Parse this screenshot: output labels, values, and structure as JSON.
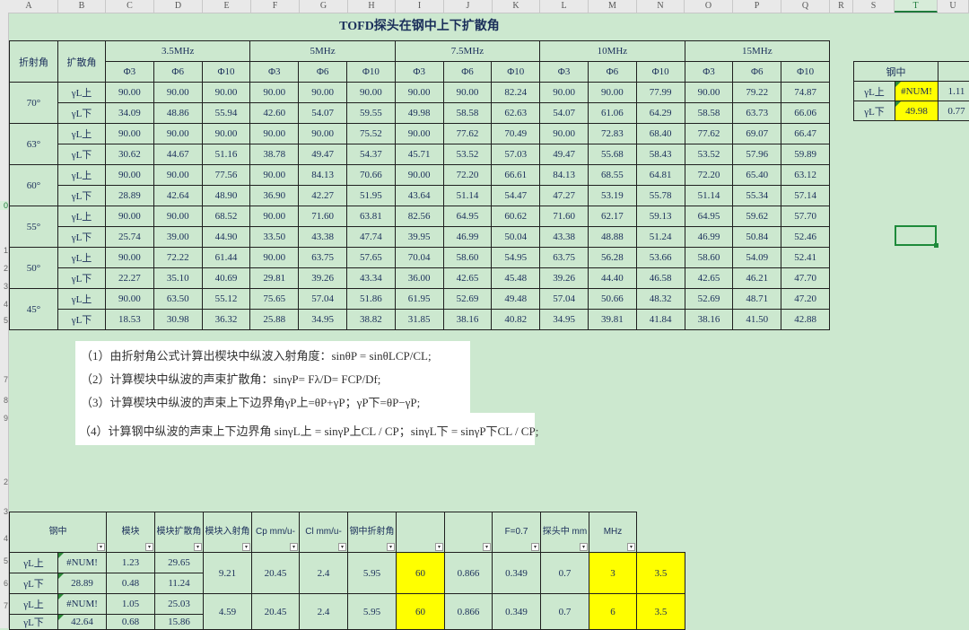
{
  "columns": [
    "A",
    "B",
    "C",
    "D",
    "E",
    "F",
    "G",
    "H",
    "I",
    "J",
    "K",
    "L",
    "M",
    "N",
    "O",
    "P",
    "Q",
    "R",
    "S",
    "T",
    "U"
  ],
  "selected_column": "T",
  "row_numbers": [
    "0",
    "1",
    "2",
    "3",
    "4",
    "5",
    "6",
    "7",
    "8"
  ],
  "title": "TOFD探头在钢中上下扩散角",
  "main_table": {
    "h_refraction": "折射角",
    "h_spread": "扩散角",
    "freqs": [
      "3.5MHz",
      "5MHz",
      "7.5MHz",
      "10MHz",
      "15MHz"
    ],
    "phis": [
      "Φ3",
      "Φ6",
      "Φ10",
      "Φ3",
      "Φ6",
      "Φ10",
      "Φ3",
      "Φ6",
      "Φ10",
      "Φ3",
      "Φ6",
      "Φ10",
      "Φ3",
      "Φ6",
      "Φ10"
    ],
    "groups": [
      {
        "angle": "70°",
        "up": [
          "90.00",
          "90.00",
          "90.00",
          "90.00",
          "90.00",
          "90.00",
          "90.00",
          "90.00",
          "82.24",
          "90.00",
          "90.00",
          "77.99",
          "90.00",
          "79.22",
          "74.87"
        ],
        "down": [
          "34.09",
          "48.86",
          "55.94",
          "42.60",
          "54.07",
          "59.55",
          "49.98",
          "58.58",
          "62.63",
          "54.07",
          "61.06",
          "64.29",
          "58.58",
          "63.73",
          "66.06"
        ]
      },
      {
        "angle": "63°",
        "up": [
          "90.00",
          "90.00",
          "90.00",
          "90.00",
          "90.00",
          "75.52",
          "90.00",
          "77.62",
          "70.49",
          "90.00",
          "72.83",
          "68.40",
          "77.62",
          "69.07",
          "66.47"
        ],
        "down": [
          "30.62",
          "44.67",
          "51.16",
          "38.78",
          "49.47",
          "54.37",
          "45.71",
          "53.52",
          "57.03",
          "49.47",
          "55.68",
          "58.43",
          "53.52",
          "57.96",
          "59.89"
        ]
      },
      {
        "angle": "60°",
        "up": [
          "90.00",
          "90.00",
          "77.56",
          "90.00",
          "84.13",
          "70.66",
          "90.00",
          "72.20",
          "66.61",
          "84.13",
          "68.55",
          "64.81",
          "72.20",
          "65.40",
          "63.12"
        ],
        "down": [
          "28.89",
          "42.64",
          "48.90",
          "36.90",
          "42.27",
          "51.95",
          "43.64",
          "51.14",
          "54.47",
          "47.27",
          "53.19",
          "55.78",
          "51.14",
          "55.34",
          "57.14"
        ]
      },
      {
        "angle": "55°",
        "up": [
          "90.00",
          "90.00",
          "68.52",
          "90.00",
          "71.60",
          "63.81",
          "82.56",
          "64.95",
          "60.62",
          "71.60",
          "62.17",
          "59.13",
          "64.95",
          "59.62",
          "57.70"
        ],
        "down": [
          "25.74",
          "39.00",
          "44.90",
          "33.50",
          "43.38",
          "47.74",
          "39.95",
          "46.99",
          "50.04",
          "43.38",
          "48.88",
          "51.24",
          "46.99",
          "50.84",
          "52.46"
        ]
      },
      {
        "angle": "50°",
        "up": [
          "90.00",
          "72.22",
          "61.44",
          "90.00",
          "63.75",
          "57.65",
          "70.04",
          "58.60",
          "54.95",
          "63.75",
          "56.28",
          "53.66",
          "58.60",
          "54.09",
          "52.41"
        ],
        "down": [
          "22.27",
          "35.10",
          "40.69",
          "29.81",
          "39.26",
          "43.34",
          "36.00",
          "42.65",
          "45.48",
          "39.26",
          "44.40",
          "46.58",
          "42.65",
          "46.21",
          "47.70"
        ]
      },
      {
        "angle": "45°",
        "up": [
          "90.00",
          "63.50",
          "55.12",
          "75.65",
          "57.04",
          "51.86",
          "61.95",
          "52.69",
          "49.48",
          "57.04",
          "50.66",
          "48.32",
          "52.69",
          "48.71",
          "47.20"
        ],
        "down": [
          "18.53",
          "30.98",
          "36.32",
          "25.88",
          "34.95",
          "38.82",
          "31.85",
          "38.16",
          "40.82",
          "34.95",
          "39.81",
          "41.84",
          "38.16",
          "41.50",
          "42.88"
        ]
      }
    ],
    "label_up": "γL上",
    "label_down": "γL下"
  },
  "side_table": {
    "header": "钢中",
    "rows": [
      {
        "label": "γL上",
        "v1": "#NUM!",
        "v2": "1.11"
      },
      {
        "label": "γL下",
        "v1": "49.98",
        "v2": "0.77"
      }
    ]
  },
  "notes": [
    "（1）由折射角公式计算出楔块中纵波入射角度：sinθP = sinθLCP/CL;",
    "（2）计算楔块中纵波的声束扩散角：sinγP= Fλ/D= FCP/Df;",
    "（3）计算楔块中纵波的声束上下边界角γP上=θP+γP；γP下=θP−γP;",
    "（4）计算钢中纵波的声束上下边界角 sinγL上 = sinγP上CL / CP；sinγL下 = sinγP下CL / CP;"
  ],
  "bottom_table": {
    "headers": [
      "钢中",
      "",
      "模块",
      "模块扩散角",
      "模块入射角",
      "Cp mm/u-",
      "Cl mm/u-",
      "钢中折射角",
      "",
      "",
      "F=0.7",
      "探头中 mm",
      "MHz"
    ],
    "rows": [
      {
        "label": "γL上",
        "v1": "#NUM!",
        "v2": "1.23",
        "v3": "29.65"
      },
      {
        "label": "γL下",
        "v1": "28.89",
        "v2": "0.48",
        "v3": "11.24"
      },
      {
        "label": "γL上",
        "v1": "#NUM!",
        "v2": "1.05",
        "v3": "25.03"
      },
      {
        "label": "γL下",
        "v1": "42.64",
        "v2": "0.68",
        "v3": "15.86"
      }
    ],
    "merged": [
      {
        "spread": "9.21",
        "incident": "20.45",
        "cp": "2.4",
        "cl": "5.95",
        "refr": "60",
        "a": "0.866",
        "b": "0.349",
        "f": "0.7",
        "d": "3",
        "mhz": "3.5"
      },
      {
        "spread": "4.59",
        "incident": "20.45",
        "cp": "2.4",
        "cl": "5.95",
        "refr": "60",
        "a": "0.866",
        "b": "0.349",
        "f": "0.7",
        "d": "6",
        "mhz": "3.5"
      }
    ]
  },
  "colors": {
    "sheet_bg": "#cce8cf",
    "highlight": "#ffff00",
    "selection": "#1d8a3a"
  }
}
